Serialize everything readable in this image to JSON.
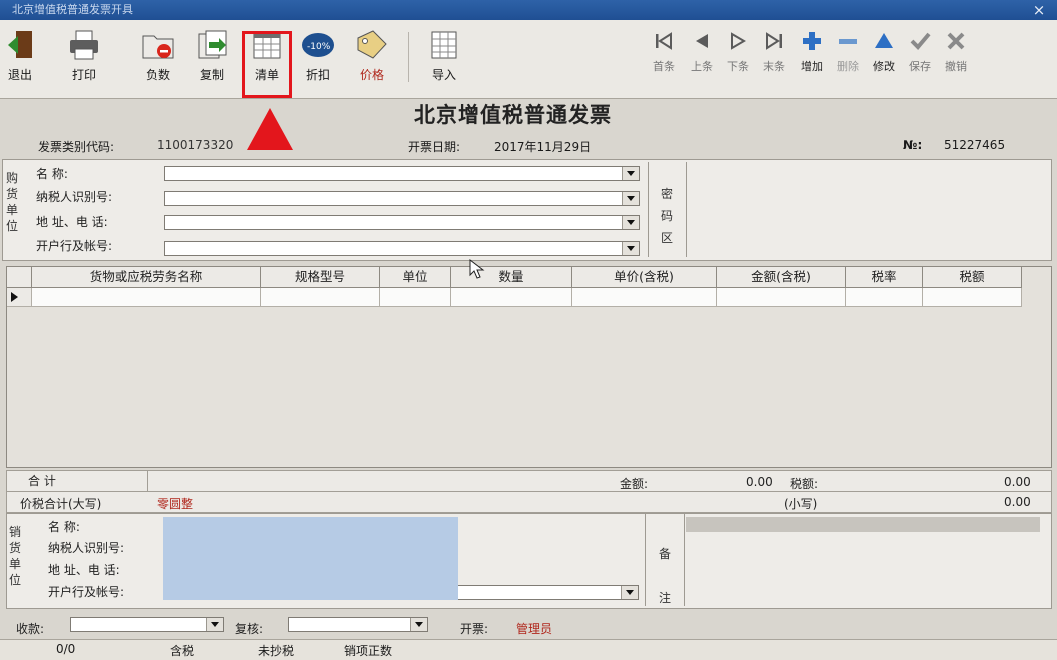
{
  "window": {
    "title": "北京增值税普通发票开具",
    "close": "×"
  },
  "toolbar": {
    "exit": "退出",
    "print": "打印",
    "negative": "负数",
    "copy": "复制",
    "list": "清单",
    "discount": "折扣",
    "price": "价格",
    "import": "导入",
    "first": "首条",
    "prev": "上条",
    "next": "下条",
    "last": "末条",
    "add": "增加",
    "delete": "删除",
    "modify": "修改",
    "save": "保存",
    "cancel": "撤销"
  },
  "invoice": {
    "title": "北京增值税普通发票",
    "type_code_label": "发票类别代码:",
    "type_code": "1100173320",
    "date_label": "开票日期:",
    "date": "2017年11月29日",
    "no_label": "№:",
    "no": "51227465"
  },
  "buyer": {
    "side_label": [
      "购",
      "货",
      "单",
      "位"
    ],
    "name_label": "名        称:",
    "tax_id_label": "纳税人识别号:",
    "address_label": "地 址、电 话:",
    "bank_label": "开户行及帐号:",
    "password_label": [
      "密",
      "码",
      "区"
    ]
  },
  "grid": {
    "columns": [
      "货物或应税劳务名称",
      "规格型号",
      "单位",
      "数量",
      "单价(含税)",
      "金额(含税)",
      "税率",
      "税额"
    ]
  },
  "totals": {
    "sum_label": "合      计",
    "amount_label": "金额:",
    "amount": "0.00",
    "tax_label": "税额:",
    "tax": "0.00",
    "total_words_label": "价税合计(大写)",
    "total_words": "零圆整",
    "small_label": "(小写)",
    "small": "0.00"
  },
  "seller": {
    "side_label": [
      "销",
      "货",
      "单",
      "位"
    ],
    "name_label": "名        称:",
    "tax_id_label": "纳税人识别号:",
    "address_label": "地 址、电 话:",
    "bank_label": "开户行及帐号:",
    "remark_label": [
      "备",
      "注"
    ]
  },
  "footer": {
    "payee_label": "收款:",
    "reviewer_label": "复核:",
    "issuer_label": "开票:",
    "issuer": "管理员"
  },
  "status": {
    "count": "0/0",
    "tax_mode": "含税",
    "copied": "未抄税",
    "item_type": "销项正数"
  },
  "colors": {
    "accent_red": "#e3161c",
    "title_blue": "#1f4f93"
  }
}
